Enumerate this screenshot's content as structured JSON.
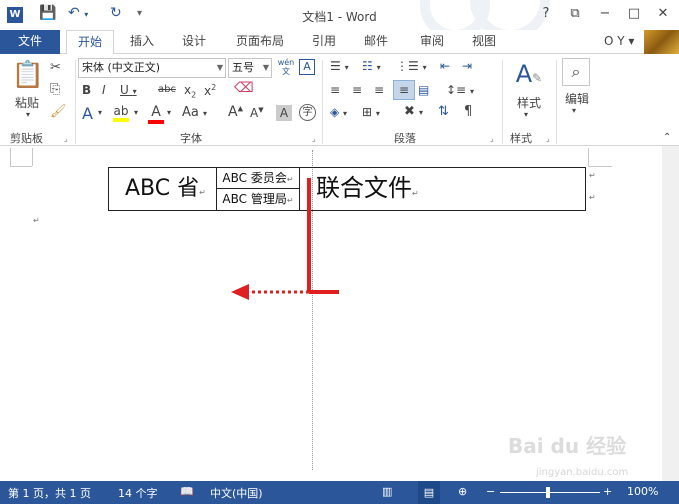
{
  "window": {
    "title": "文档1 - Word",
    "app_icon": "W",
    "controls": [
      "?",
      "⧉",
      "−",
      "□",
      "✕"
    ]
  },
  "qat": {
    "save_icon": "save-icon",
    "undo_icon": "undo-icon",
    "redo_icon": "redo-icon"
  },
  "tabs": {
    "file": "文件",
    "items": [
      "开始",
      "插入",
      "设计",
      "页面布局",
      "引用",
      "邮件",
      "审阅",
      "视图"
    ],
    "active": "开始",
    "user": "O Y ▾"
  },
  "ribbon": {
    "clipboard": {
      "label": "剪贴板",
      "paste": "粘贴"
    },
    "font": {
      "label": "字体",
      "font_name": "宋体 (中文正文)",
      "font_size": "五号",
      "wen": "wén 文",
      "A_box": "A"
    },
    "paragraph": {
      "label": "段落"
    },
    "styles": {
      "label": "样式",
      "button": "样式"
    },
    "editing": {
      "button": "编辑"
    }
  },
  "document": {
    "left_cell": "ABC 省",
    "mid_top": "ABC 委员会",
    "mid_bottom": "ABC 管理局",
    "right_cell": "联合文件"
  },
  "status": {
    "page": "第 1 页，共 1 页",
    "words": "14 个字",
    "lang": "中文(中国)",
    "zoom": "100%"
  },
  "watermark": {
    "text": "Bai du 经验",
    "url": "jingyan.baidu.com"
  },
  "colors": {
    "accent": "#2b579a",
    "arrow": "#e02020",
    "highlight": "#ffff00",
    "font_red": "#ff0000"
  }
}
